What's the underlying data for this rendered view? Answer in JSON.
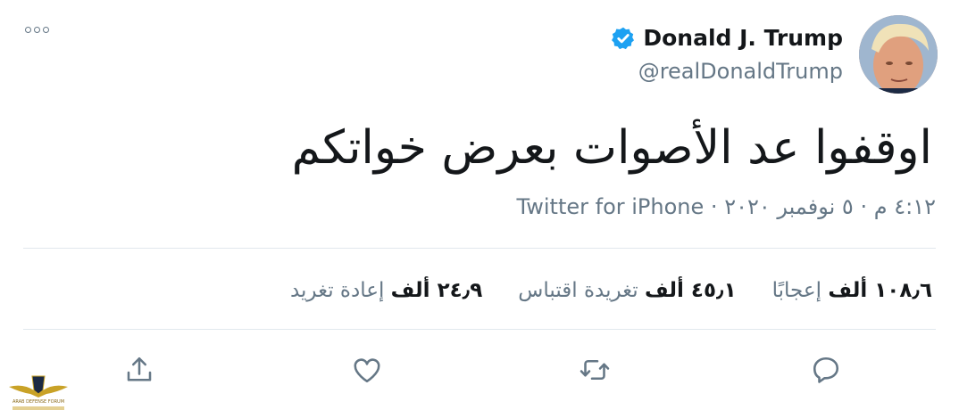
{
  "tweet": {
    "display_name": "Donald J. Trump",
    "handle": "@realDonaldTrump",
    "verified_icon": "verified-badge-icon",
    "text": "اوقفوا عد الأصوات بعرض خواتكم",
    "time": "٤:١٢ م",
    "date": "٥ نوفمبر ٢٠٢٠",
    "separator": "·",
    "source": "Twitter for iPhone"
  },
  "stats": {
    "retweets_count": "٢٤٫٩ ألف",
    "retweets_label": "إعادة تغريد",
    "quotes_count": "٤٥٫١ ألف",
    "quotes_label": "تغريدة اقتباس",
    "likes_count": "١٠٨٫٦ ألف",
    "likes_label": "إعجابًا"
  },
  "actions": {
    "reply_icon": "reply-icon",
    "retweet_icon": "retweet-icon",
    "like_icon": "heart-icon",
    "share_icon": "share-icon",
    "more_icon": "more-options-icon"
  },
  "colors": {
    "accent": "#1da1f2",
    "muted": "#657786",
    "text": "#14171a",
    "divider": "#e1e8ed"
  },
  "watermark": {
    "line1": "ARAB DEFENSE FORUM"
  }
}
